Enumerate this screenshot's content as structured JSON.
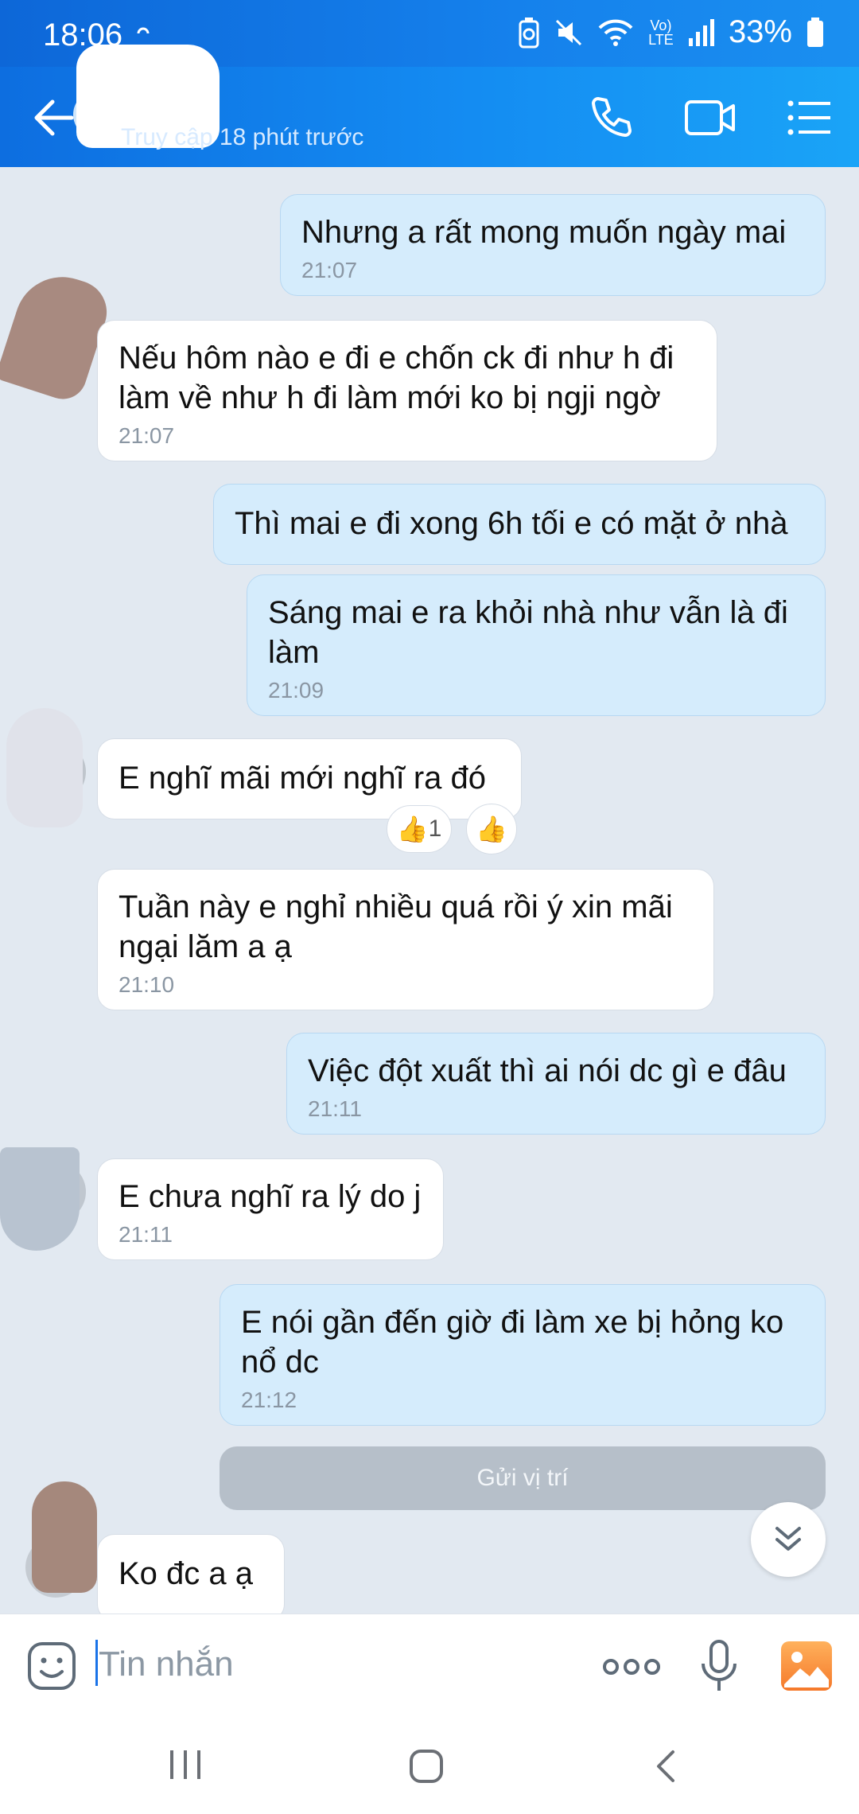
{
  "status": {
    "time": "18:06",
    "battery": "33%",
    "lte": "LTE"
  },
  "header": {
    "subtitle": "Truy cập 18 phút trước"
  },
  "messages": [
    {
      "dir": "out",
      "text": "Nhưng a rất mong muốn ngày mai",
      "time": "21:07"
    },
    {
      "dir": "in",
      "text": "Nếu hôm nào e đi e chốn ck đi như h đi làm về như h đi làm mới ko bị ngji ngờ",
      "time": "21:07"
    },
    {
      "dir": "out",
      "text": "Thì mai e đi xong 6h tối e có mặt ở nhà"
    },
    {
      "dir": "out",
      "text": "Sáng mai e ra khỏi nhà như vẫn là đi làm",
      "time": "21:09"
    },
    {
      "dir": "in",
      "text": "E nghĩ mãi mới nghĩ ra đó"
    },
    {
      "dir": "in",
      "text": "Tuần này e nghỉ nhiều quá rồi ý xin mãi ngại lăm a ạ",
      "time": "21:10"
    },
    {
      "dir": "out",
      "text": "Việc đột xuất thì ai nói dc gì e đâu",
      "time": "21:11"
    },
    {
      "dir": "in",
      "text": "E chưa nghĩ ra lý do j",
      "time": "21:11"
    },
    {
      "dir": "out",
      "text": "E nói gần đến giờ đi làm xe bị hỏng ko nổ dc",
      "time": "21:12"
    },
    {
      "dir": "in",
      "text": "Ko đc a ạ"
    }
  ],
  "reaction": {
    "count": "1"
  },
  "location_button": "Gửi vị trí",
  "input": {
    "placeholder": "Tin nhắn"
  },
  "colors": {
    "header": "#148cf2",
    "out_bubble": "#d5ecfc",
    "in_bubble": "#ffffff",
    "background": "#e2e9f1"
  }
}
